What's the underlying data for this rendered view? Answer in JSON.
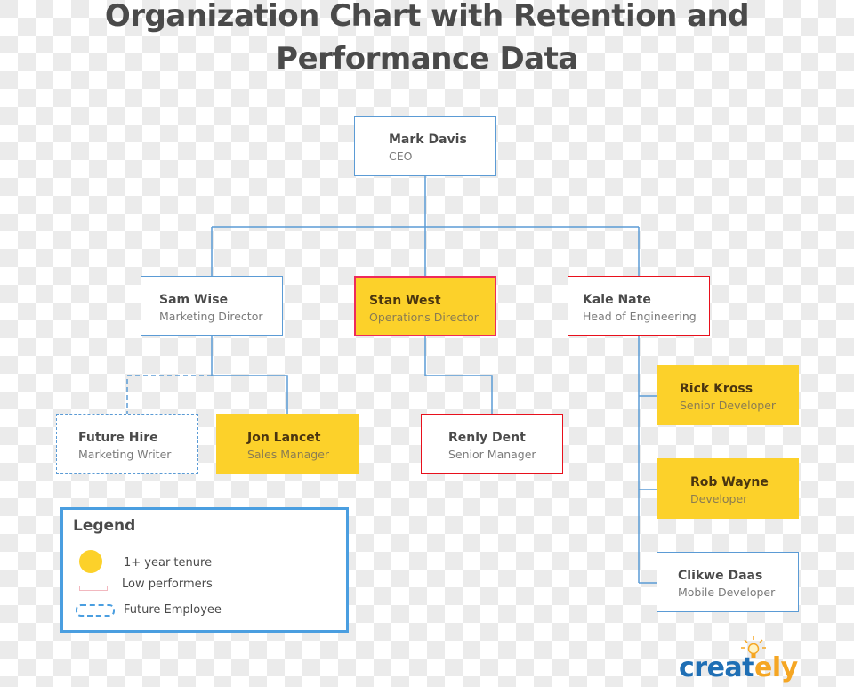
{
  "title": {
    "line1": "Organization Chart with Retention and",
    "line2": "Performance Data"
  },
  "colors": {
    "connector": "#5b9bd5",
    "tenure_fill": "#fcd12a",
    "low_performer_border": "#e8101c",
    "future_border": "#5b9bd5",
    "legend_border": "#4a9ee0"
  },
  "nodes": {
    "ceo": {
      "name": "Mark Davis",
      "role": "CEO",
      "tenure": false,
      "low_performer": false,
      "future": false
    },
    "marketing_director": {
      "name": "Sam Wise",
      "role": "Marketing Director",
      "tenure": false,
      "low_performer": false,
      "future": false
    },
    "operations_director": {
      "name": "Stan West",
      "role": "Operations Director",
      "tenure": true,
      "low_performer": true,
      "future": false
    },
    "head_engineering": {
      "name": "Kale Nate",
      "role": "Head of Engineering",
      "tenure": false,
      "low_performer": true,
      "future": false
    },
    "future_hire": {
      "name": "Future Hire",
      "role": "Marketing Writer",
      "tenure": false,
      "low_performer": false,
      "future": true
    },
    "sales_manager": {
      "name": "Jon Lancet",
      "role": "Sales Manager",
      "tenure": true,
      "low_performer": false,
      "future": false
    },
    "senior_manager": {
      "name": "Renly Dent",
      "role": "Senior Manager",
      "tenure": false,
      "low_performer": true,
      "future": false
    },
    "senior_developer": {
      "name": "Rick Kross",
      "role": "Senior Developer",
      "tenure": true,
      "low_performer": false,
      "future": false
    },
    "developer": {
      "name": "Rob Wayne",
      "role": "Developer",
      "tenure": true,
      "low_performer": false,
      "future": false
    },
    "mobile_developer": {
      "name": "Clikwe Daas",
      "role": "Mobile Developer",
      "tenure": false,
      "low_performer": false,
      "future": false
    }
  },
  "hierarchy": [
    {
      "parent": "ceo",
      "children": [
        "marketing_director",
        "operations_director",
        "head_engineering"
      ]
    },
    {
      "parent": "marketing_director",
      "children": [
        "future_hire",
        "sales_manager"
      ]
    },
    {
      "parent": "operations_director",
      "children": [
        "senior_manager"
      ]
    },
    {
      "parent": "head_engineering",
      "children": [
        "senior_developer",
        "developer",
        "mobile_developer"
      ]
    }
  ],
  "legend": {
    "title": "Legend",
    "items": [
      {
        "symbol": "yellow-circle",
        "label": "1+ year tenure"
      },
      {
        "symbol": "red-outline-rect",
        "label": "Low performers"
      },
      {
        "symbol": "dashed-blue-rect",
        "label": "Future Employee"
      }
    ]
  },
  "logo": {
    "main": "creat",
    "accent": "ely"
  }
}
